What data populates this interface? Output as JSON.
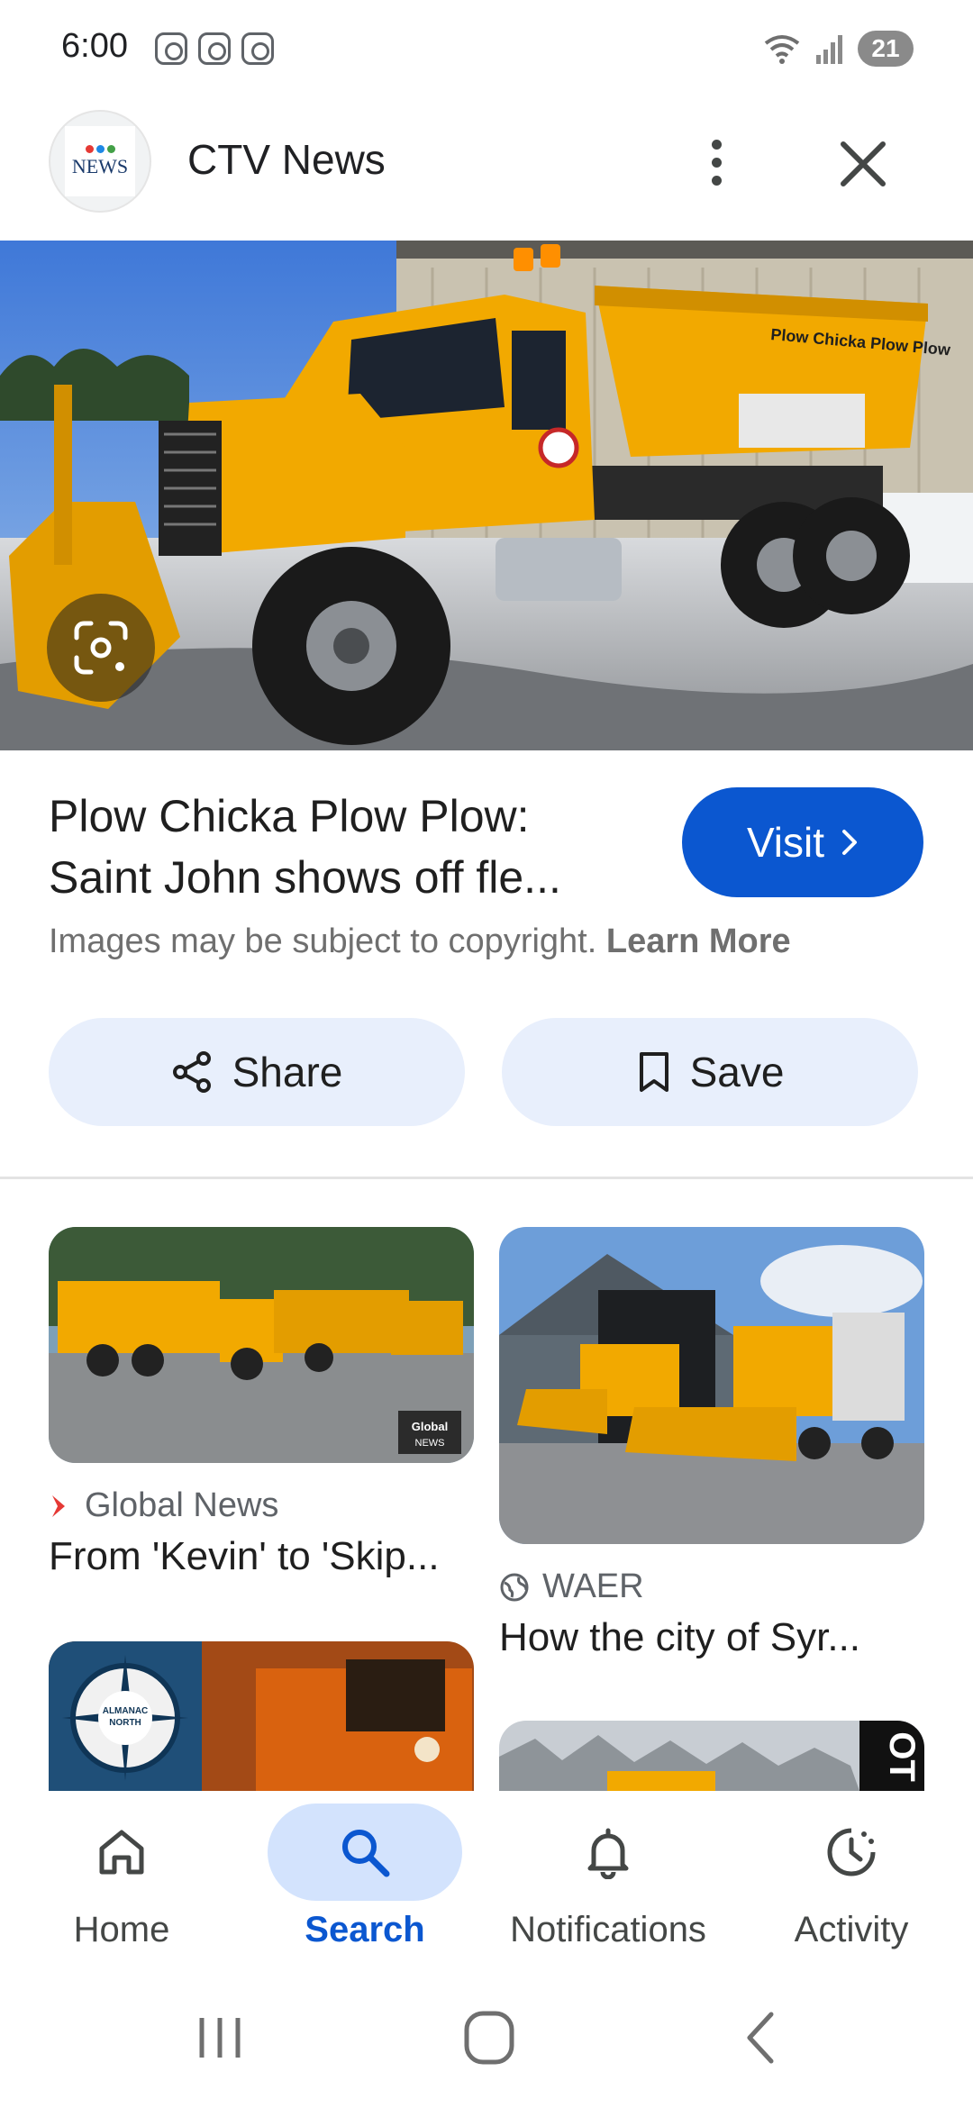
{
  "status_bar": {
    "time": "6:00",
    "battery_level": "21",
    "icons": [
      "instagram-icon",
      "screenshot-icon",
      "instagram-icon",
      "wifi-icon",
      "signal-icon"
    ]
  },
  "header": {
    "source_name": "CTV News",
    "logo_text": "NEWS",
    "more_icon": "more-vert-icon",
    "close_icon": "close-icon"
  },
  "main_image": {
    "truck_text": "Plow Chicka Plow Plow",
    "lens_icon": "google-lens-icon"
  },
  "result": {
    "title": "Plow Chicka Plow Plow: Saint John shows off fle...",
    "visit_label": "Visit",
    "copyright_text": "Images may be subject to copyright.",
    "learn_more": "Learn More"
  },
  "actions": {
    "share_label": "Share",
    "save_label": "Save"
  },
  "related": [
    {
      "source": "Global News",
      "caption": "From 'Kevin' to 'Skip...",
      "watermark": "Global NEWS"
    },
    {
      "source": "WAER",
      "caption": "How the city of Syr..."
    },
    {
      "badge": "ALMANAC NORTH"
    },
    {
      "badge": "OT"
    }
  ],
  "bottom_nav": [
    {
      "label": "Home",
      "icon": "home-icon",
      "active": false
    },
    {
      "label": "Search",
      "icon": "search-icon",
      "active": true
    },
    {
      "label": "Notifications",
      "icon": "bell-icon",
      "active": false
    },
    {
      "label": "Activity",
      "icon": "activity-icon",
      "active": false
    }
  ],
  "colors": {
    "accent": "#0b57d0",
    "action_bg": "#e8effc",
    "nav_active_bg": "#d3e3fd",
    "truck_yellow": "#f2a900"
  }
}
